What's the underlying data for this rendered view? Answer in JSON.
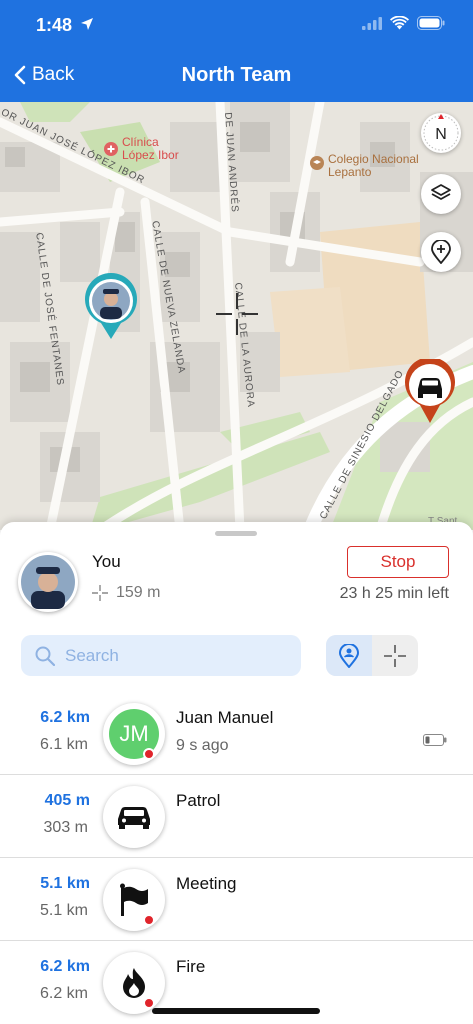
{
  "status_bar": {
    "time": "1:48"
  },
  "nav": {
    "back_label": "Back",
    "title": "North Team"
  },
  "map": {
    "streets": [
      "OR JUAN JOSÉ LÓPEZ IBOR",
      "CALLE DE JOSÉ FENTANES",
      "CALLE DE NUEVA ZELANDA",
      "DE JUAN ANDRÉS",
      "CALLE DE LA AURORA",
      "CALLE DE SINESIO DELGADO"
    ],
    "pois": [
      {
        "name": "Clínica López Ibor",
        "line1": "Clínica",
        "line2": "López Ibor"
      },
      {
        "name": "Colegio Nacional Lepanto",
        "line1": "Colegio Nacional",
        "line2": "Lepanto"
      }
    ],
    "compass_label": "N",
    "attribution": "T Sant",
    "icons": [
      "compass-icon",
      "layers-icon",
      "add-place-icon",
      "crosshair-icon",
      "car-icon"
    ]
  },
  "me": {
    "name": "You",
    "distance": "159 m",
    "stop_label": "Stop",
    "time_left": "23 h 25 min left"
  },
  "search": {
    "placeholder": "Search"
  },
  "members": [
    {
      "dist_primary": "6.2 km",
      "dist_secondary": "6.1 km",
      "name": "Juan Manuel",
      "subtitle": "9 s ago",
      "initials": "JM",
      "icon": "initials",
      "alert_dot": true,
      "battery": true
    },
    {
      "dist_primary": "405 m",
      "dist_secondary": "303 m",
      "name": "Patrol",
      "subtitle": "",
      "icon": "car-icon",
      "alert_dot": false,
      "battery": false
    },
    {
      "dist_primary": "5.1 km",
      "dist_secondary": "5.1 km",
      "name": "Meeting",
      "subtitle": "",
      "icon": "flag-icon",
      "alert_dot": true,
      "battery": false
    },
    {
      "dist_primary": "6.2 km",
      "dist_secondary": "6.2 km",
      "name": "Fire",
      "subtitle": "",
      "icon": "fire-icon",
      "alert_dot": true,
      "battery": false
    }
  ],
  "colors": {
    "brand": "#1f72e0",
    "stop": "#d9302c",
    "avatar_green": "#5fcf6e",
    "alert": "#e0242b",
    "teal_marker": "#27a9b9",
    "red_marker": "#c5431a"
  }
}
